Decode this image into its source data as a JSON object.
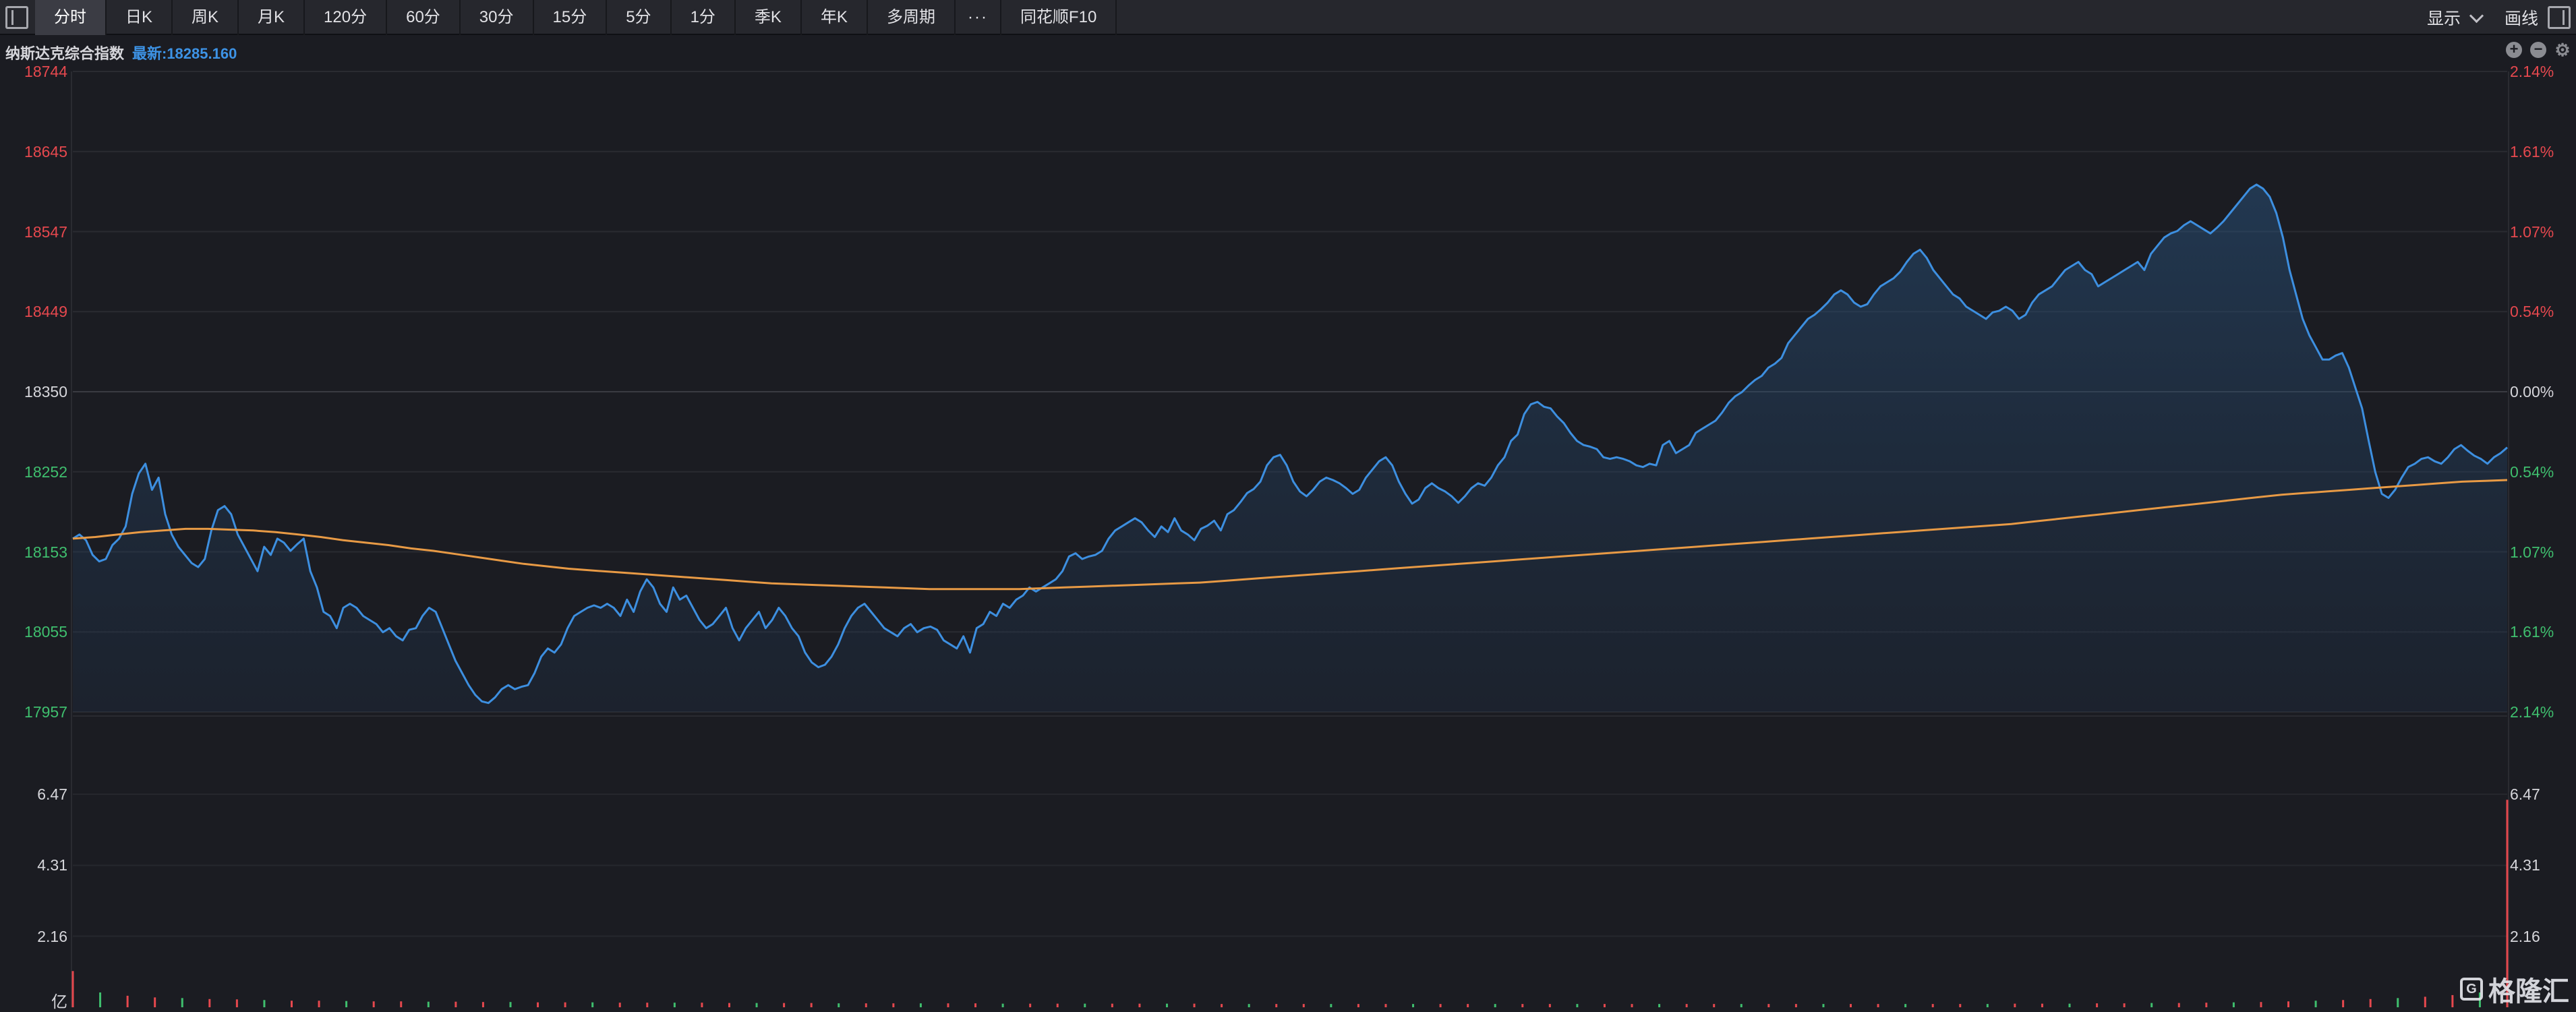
{
  "toolbar": {
    "tabs": [
      "分时",
      "日K",
      "周K",
      "月K",
      "120分",
      "60分",
      "30分",
      "15分",
      "5分",
      "1分",
      "季K",
      "年K",
      "多周期",
      "···",
      "同花顺F10"
    ],
    "active_tab": 0,
    "display_label": "显示",
    "draw_label": "画线"
  },
  "info": {
    "index_name": "纳斯达克综合指数",
    "latest": "最新:18285.160"
  },
  "price_axis": {
    "left": [
      "18744",
      "18645",
      "18547",
      "18449",
      "18350",
      "18252",
      "18153",
      "18055",
      "17957"
    ],
    "right": [
      "2.14%",
      "1.61%",
      "1.07%",
      "0.54%",
      "0.00%",
      "0.54%",
      "1.07%",
      "1.61%",
      "2.14%"
    ],
    "directions": [
      "up",
      "up",
      "up",
      "up",
      "flat",
      "down",
      "down",
      "down",
      "down"
    ]
  },
  "volume_axis": {
    "left": [
      "6.47",
      "4.31",
      "2.16"
    ],
    "right": [
      "6.47",
      "4.31",
      "2.16"
    ],
    "unit": "亿"
  },
  "watermark": "格隆汇",
  "colors": {
    "price_line": "#3d8fe0",
    "avg_line": "#e89a45",
    "up": "#e6484e",
    "down": "#3fbf6e",
    "volume_bar": "#e6484e"
  },
  "chart_data": {
    "type": "line",
    "title": "纳斯达克综合指数",
    "prev_close": 18350,
    "ylim": [
      17957,
      18744
    ],
    "volume_ylim": [
      0,
      6.47
    ],
    "series": [
      {
        "name": "price",
        "values": [
          18170,
          18175,
          18168,
          18150,
          18142,
          18145,
          18162,
          18170,
          18185,
          18225,
          18250,
          18262,
          18230,
          18245,
          18200,
          18175,
          18160,
          18150,
          18140,
          18135,
          18145,
          18180,
          18205,
          18210,
          18200,
          18175,
          18160,
          18145,
          18130,
          18160,
          18150,
          18170,
          18165,
          18155,
          18163,
          18170,
          18130,
          18110,
          18080,
          18075,
          18060,
          18085,
          18090,
          18085,
          18075,
          18070,
          18065,
          18055,
          18060,
          18050,
          18045,
          18058,
          18060,
          18075,
          18085,
          18080,
          18060,
          18040,
          18020,
          18005,
          17990,
          17978,
          17970,
          17968,
          17975,
          17985,
          17990,
          17985,
          17988,
          17990,
          18005,
          18025,
          18035,
          18030,
          18040,
          18060,
          18075,
          18080,
          18085,
          18088,
          18085,
          18090,
          18085,
          18075,
          18095,
          18080,
          18105,
          18120,
          18110,
          18090,
          18080,
          18110,
          18095,
          18100,
          18085,
          18070,
          18060,
          18065,
          18075,
          18085,
          18060,
          18045,
          18060,
          18070,
          18080,
          18060,
          18070,
          18085,
          18075,
          18060,
          18050,
          18030,
          18018,
          18012,
          18015,
          18025,
          18040,
          18060,
          18075,
          18085,
          18090,
          18080,
          18070,
          18060,
          18055,
          18050,
          18060,
          18065,
          18055,
          18060,
          18062,
          18058,
          18045,
          18040,
          18035,
          18050,
          18030,
          18060,
          18065,
          18080,
          18075,
          18090,
          18085,
          18095,
          18100,
          18110,
          18105,
          18110,
          18115,
          18120,
          18130,
          18148,
          18152,
          18145,
          18148,
          18150,
          18155,
          18170,
          18180,
          18185,
          18190,
          18195,
          18190,
          18180,
          18172,
          18185,
          18178,
          18195,
          18180,
          18175,
          18168,
          18182,
          18186,
          18192,
          18180,
          18200,
          18205,
          18215,
          18226,
          18231,
          18240,
          18260,
          18270,
          18273,
          18260,
          18240,
          18228,
          18222,
          18230,
          18240,
          18245,
          18242,
          18238,
          18232,
          18225,
          18230,
          18245,
          18255,
          18265,
          18270,
          18260,
          18240,
          18225,
          18213,
          18218,
          18232,
          18238,
          18232,
          18228,
          18222,
          18214,
          18222,
          18232,
          18238,
          18235,
          18245,
          18260,
          18270,
          18290,
          18298,
          18323,
          18335,
          18338,
          18332,
          18330,
          18320,
          18312,
          18300,
          18290,
          18285,
          18283,
          18280,
          18270,
          18268,
          18270,
          18268,
          18265,
          18260,
          18258,
          18262,
          18260,
          18285,
          18290,
          18275,
          18280,
          18285,
          18300,
          18305,
          18310,
          18315,
          18325,
          18337,
          18345,
          18350,
          18358,
          18365,
          18370,
          18380,
          18385,
          18392,
          18410,
          18420,
          18430,
          18440,
          18445,
          18452,
          18460,
          18470,
          18475,
          18470,
          18460,
          18455,
          18458,
          18470,
          18480,
          18485,
          18490,
          18498,
          18510,
          18520,
          18525,
          18515,
          18500,
          18490,
          18480,
          18470,
          18465,
          18455,
          18450,
          18445,
          18440,
          18448,
          18450,
          18455,
          18450,
          18440,
          18445,
          18460,
          18470,
          18475,
          18480,
          18490,
          18500,
          18505,
          18510,
          18500,
          18495,
          18480,
          18485,
          18490,
          18495,
          18500,
          18505,
          18510,
          18500,
          18520,
          18530,
          18540,
          18545,
          18548,
          18555,
          18560,
          18555,
          18550,
          18545,
          18552,
          18560,
          18570,
          18580,
          18590,
          18600,
          18605,
          18600,
          18590,
          18570,
          18540,
          18500,
          18470,
          18440,
          18420,
          18405,
          18390,
          18390,
          18395,
          18398,
          18380,
          18355,
          18330,
          18290,
          18252,
          18225,
          18220,
          18230,
          18245,
          18258,
          18262,
          18268,
          18270,
          18265,
          18262,
          18270,
          18280,
          18285,
          18278,
          18272,
          18268,
          18262,
          18270,
          18275,
          18282
        ]
      },
      {
        "name": "average",
        "values": [
          18170,
          18172,
          18175,
          18178,
          18180,
          18182,
          18182,
          18181,
          18180,
          18178,
          18175,
          18172,
          18168,
          18165,
          18162,
          18158,
          18155,
          18151,
          18147,
          18143,
          18139,
          18136,
          18133,
          18131,
          18129,
          18127,
          18125,
          18123,
          18121,
          18119,
          18117,
          18115,
          18114,
          18113,
          18112,
          18111,
          18110,
          18109,
          18108,
          18108,
          18108,
          18108,
          18108,
          18109,
          18110,
          18111,
          18112,
          18113,
          18114,
          18115,
          18116,
          18118,
          18120,
          18122,
          18124,
          18126,
          18128,
          18130,
          18132,
          18134,
          18136,
          18138,
          18140,
          18142,
          18144,
          18146,
          18148,
          18150,
          18152,
          18154,
          18156,
          18158,
          18160,
          18162,
          18164,
          18166,
          18168,
          18170,
          18172,
          18174,
          18176,
          18178,
          18180,
          18182,
          18184,
          18186,
          18188,
          18191,
          18194,
          18197,
          18200,
          18203,
          18206,
          18209,
          18212,
          18215,
          18218,
          18221,
          18224,
          18226,
          18228,
          18230,
          18232,
          18234,
          18236,
          18238,
          18240,
          18241,
          18242
        ]
      }
    ],
    "volume": [
      1.1,
      0.45,
      0.35,
      0.3,
      0.28,
      0.25,
      0.24,
      0.22,
      0.2,
      0.2,
      0.19,
      0.18,
      0.18,
      0.17,
      0.17,
      0.16,
      0.16,
      0.15,
      0.15,
      0.15,
      0.14,
      0.14,
      0.14,
      0.14,
      0.13,
      0.13,
      0.13,
      0.13,
      0.12,
      0.12,
      0.12,
      0.12,
      0.12,
      0.12,
      0.11,
      0.11,
      0.11,
      0.11,
      0.11,
      0.11,
      0.11,
      0.11,
      0.1,
      0.1,
      0.1,
      0.1,
      0.1,
      0.1,
      0.1,
      0.1,
      0.1,
      0.1,
      0.1,
      0.1,
      0.1,
      0.1,
      0.1,
      0.1,
      0.1,
      0.1,
      0.1,
      0.1,
      0.1,
      0.1,
      0.1,
      0.1,
      0.1,
      0.1,
      0.1,
      0.1,
      0.1,
      0.11,
      0.11,
      0.11,
      0.12,
      0.12,
      0.13,
      0.13,
      0.14,
      0.15,
      0.16,
      0.18,
      0.2,
      0.22,
      0.25,
      0.28,
      0.32,
      0.37,
      0.45,
      6.3
    ]
  }
}
